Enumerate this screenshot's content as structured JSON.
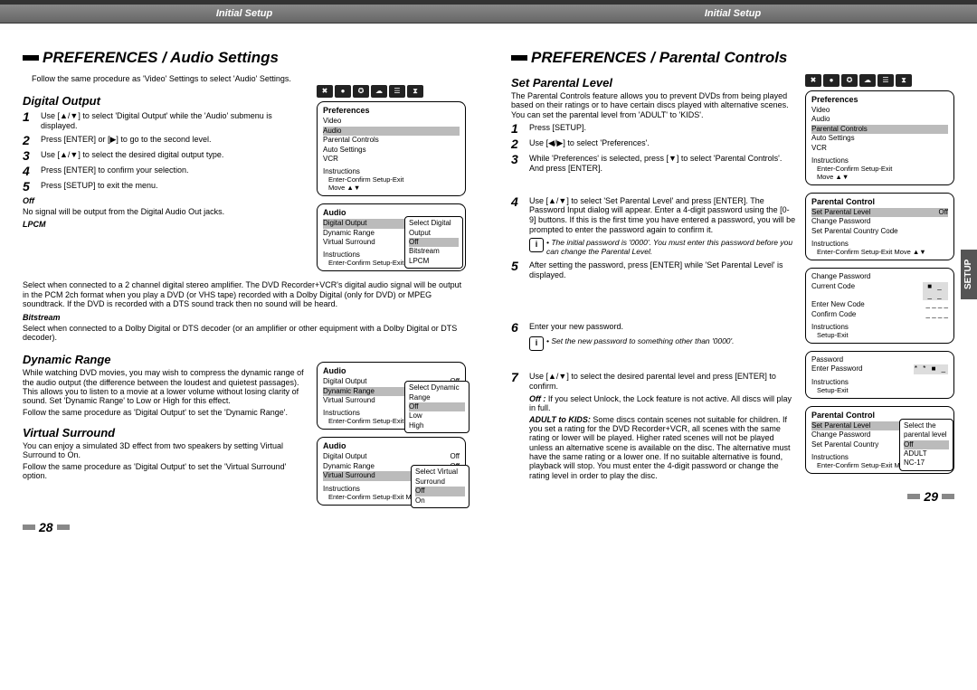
{
  "header": {
    "left": "Initial Setup",
    "right": "Initial Setup"
  },
  "side_tab": "SETUP",
  "page_nums": {
    "left": "28",
    "right": "29"
  },
  "left_page": {
    "title": "PREFERENCES / Audio Settings",
    "intro": "Follow the same procedure as 'Video' Settings to select 'Audio' Settings.",
    "digital_output": {
      "title": "Digital Output",
      "steps": [
        "Use [▲/▼] to select 'Digital Output' while the 'Audio' submenu is displayed.",
        "Press [ENTER] or [▶] to go to the second level.",
        "Use [▲/▼] to select the desired digital output type.",
        "Press [ENTER] to confirm your selection.",
        "Press [SETUP] to exit the menu."
      ],
      "off_label": "Off",
      "off_text": "No signal will be output from the Digital Audio Out jacks.",
      "lpcm_label": "LPCM",
      "lpcm_text": "Select when connected to a 2 channel digital stereo amplifier. The DVD Recorder+VCR's digital audio signal will be output in the PCM 2ch format when you play a DVD (or VHS tape) recorded with a Dolby Digital (only for DVD) or MPEG soundtrack. If the DVD is recorded with a DTS sound track then no sound will be heard.",
      "bitstream_label": "Bitstream",
      "bitstream_text": "Select when connected to a Dolby Digital or DTS decoder (or an amplifier or other equipment with a Dolby Digital or DTS decoder)."
    },
    "dynamic_range": {
      "title": "Dynamic Range",
      "text1": "While watching DVD movies, you may wish to compress the dynamic range of the audio output (the difference between the loudest and quietest passages). This allows you to listen to a movie at a lower volume without losing clarity of sound. Set 'Dynamic Range' to Low or High for this effect.",
      "text2": "Follow the same procedure as 'Digital Output' to set the 'Dynamic Range'."
    },
    "virtual_surround": {
      "title": "Virtual Surround",
      "text1": "You can enjoy a simulated 3D effect from two speakers by setting Virtual Surround to On.",
      "text2": "Follow the same procedure as 'Digital Output' to set the 'Virtual Surround' option."
    },
    "osd": {
      "prefs": {
        "title": "Preferences",
        "items": [
          "Video",
          "Audio",
          "Parental Controls",
          "Auto Settings",
          "VCR"
        ],
        "highlight_idx": 1,
        "instr_label": "Instructions",
        "instr1": "Enter-Confirm   Setup-Exit",
        "instr2": "Move ▲▼"
      },
      "audio1": {
        "title": "Audio",
        "rows": [
          [
            "Digital Output",
            ""
          ],
          [
            "Dynamic Range",
            ""
          ],
          [
            "Virtual Surround",
            ""
          ]
        ],
        "highlight_idx": 0,
        "popup_title": "Select Digital Output",
        "popup_items": [
          "Off",
          "Bitstream",
          "LPCM"
        ],
        "popup_hl": 0,
        "instr_label": "Instructions",
        "instr": "Enter-Confirm  Setup-Exit  Move ▲▼"
      },
      "audio2": {
        "title": "Audio",
        "rows": [
          [
            "Digital Output",
            "Off"
          ],
          [
            "Dynamic Range",
            ""
          ],
          [
            "Virtual Surround",
            ""
          ]
        ],
        "highlight_idx": 1,
        "popup_title": "Select Dynamic Range",
        "popup_items": [
          "Off",
          "Low",
          "High"
        ],
        "popup_hl": 0,
        "instr_label": "Instructions",
        "instr": "Enter-Confirm  Setup-Exit  Move ▲▼"
      },
      "audio3": {
        "title": "Audio",
        "rows": [
          [
            "Digital Output",
            "Off"
          ],
          [
            "Dynamic Range",
            "Off"
          ],
          [
            "Virtual Surround",
            ""
          ]
        ],
        "highlight_idx": 2,
        "popup_title": "Select Virtual Surround",
        "popup_items": [
          "Off",
          "On"
        ],
        "popup_hl": 0,
        "instr_label": "Instructions",
        "instr": "Enter-Confirm  Setup-Exit  Move ▲▼"
      }
    }
  },
  "right_page": {
    "title": "PREFERENCES / Parental Controls",
    "set_parental_level": {
      "title": "Set Parental Level",
      "intro": "The Parental Controls feature allows you to prevent DVDs from being played based on their ratings or to have certain discs played with alternative scenes. You can set the parental level from 'ADULT' to 'KIDS'.",
      "steps123": [
        "Press [SETUP].",
        "Use [◀/▶] to select 'Preferences'.",
        "While 'Preferences' is selected, press [▼] to select 'Parental Controls'. And press [ENTER]."
      ],
      "step4": "Use [▲/▼] to select 'Set Parental Level' and press [ENTER]. The Password Input dialog will appear. Enter a 4-digit password using the [0-9] buttons. If this is the first time you have entered a password, you will be prompted to enter the password again to confirm it.",
      "note1": "The initial password is '0000'. You must enter this password before you can change the Parental Level.",
      "step5": "After setting the password, press [ENTER] while 'Set Parental Level' is displayed.",
      "step6": "Enter your new password.",
      "note2": "Set the new password to something other than '0000'.",
      "step7": "Use [▲/▼] to select the desired parental level and press [ENTER] to confirm.",
      "off_note_label": "Off :",
      "off_note": "If you select Unlock, the Lock feature is not active. All discs will play in full.",
      "adult_label": "ADULT to KIDS:",
      "adult_note": "Some discs contain scenes not suitable for children. If you set a rating for the DVD Recorder+VCR, all scenes with the same rating or lower will be played. Higher rated scenes will not be played unless an alternative scene is available on the disc. The alternative must have the same rating or a lower one. If no suitable alternative is found, playback will stop. You must enter the 4-digit password or change the rating level in order to play the disc."
    },
    "osd": {
      "prefs": {
        "title": "Preferences",
        "items": [
          "Video",
          "Audio",
          "Parental Controls",
          "Auto Settings",
          "VCR"
        ],
        "highlight_idx": 2,
        "instr_label": "Instructions",
        "instr1": "Enter-Confirm   Setup-Exit",
        "instr2": "Move ▲▼"
      },
      "pc1": {
        "title": "Parental Control",
        "rows": [
          [
            "Set Parental Level",
            "Off"
          ],
          [
            "Change Password",
            ""
          ],
          [
            "Set Parental Country Code",
            ""
          ]
        ],
        "highlight_idx": 0,
        "instr_label": "Instructions",
        "instr": "Enter-Confirm  Setup-Exit  Move ▲▼"
      },
      "pw_change": {
        "rows": [
          "Change Password",
          "Current Code",
          "Enter New Code",
          "Confirm Code"
        ],
        "current": "■ _ _ _",
        "new": "_ _ _ _",
        "confirm": "_ _ _ _",
        "instr_label": "Instructions",
        "instr": "Setup-Exit"
      },
      "pw_enter": {
        "rows": [
          "Password",
          "Enter Password"
        ],
        "value": "* * ■ _",
        "instr_label": "Instructions",
        "instr": "Setup-Exit"
      },
      "pc2": {
        "title": "Parental Control",
        "rows": [
          [
            "Set Parental Level",
            ""
          ],
          [
            "Change Password",
            ""
          ],
          [
            "Set Parental Country",
            ""
          ]
        ],
        "highlight_idx": 0,
        "popup_title": "Select the parental level",
        "popup_items": [
          "Off",
          "ADULT",
          "NC-17"
        ],
        "popup_hl": 0,
        "instr_label": "Instructions",
        "instr": "Enter-Confirm  Setup-Exit  Move ▲▼"
      }
    }
  }
}
